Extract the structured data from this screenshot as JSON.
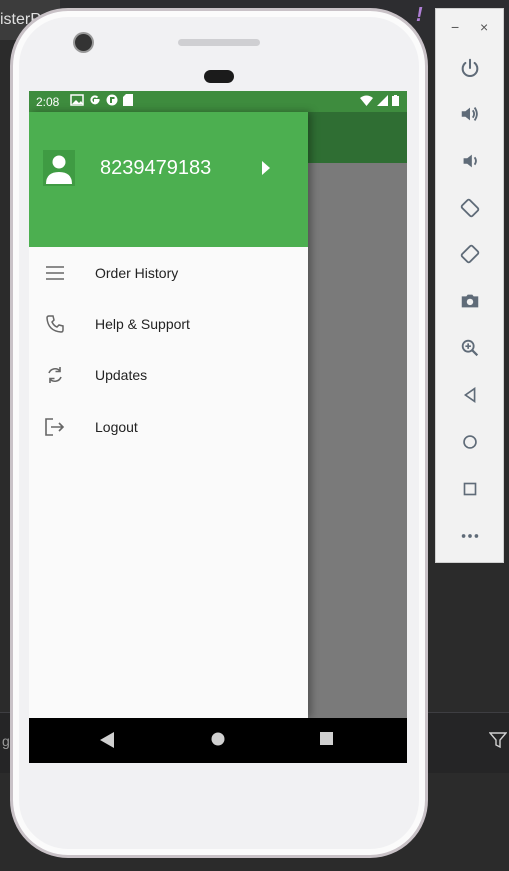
{
  "ide": {
    "tab_fragment": "isterP",
    "bottom_fragment": "g"
  },
  "emulator_toolbar": {
    "minimize_label": "−",
    "close_label": "×",
    "buttons": [
      "power-icon",
      "volume-up-icon",
      "volume-down-icon",
      "rotate-left-icon",
      "rotate-right-icon",
      "camera-icon",
      "zoom-icon",
      "back-icon",
      "home-icon",
      "overview-icon",
      "more-icon"
    ]
  },
  "status_bar": {
    "time": "2:08"
  },
  "drawer": {
    "phone_number": "8239479183",
    "items": [
      {
        "label": "Order History",
        "icon": "menu-icon"
      },
      {
        "label": "Help & Support",
        "icon": "phone-icon"
      },
      {
        "label": "Updates",
        "icon": "sync-icon"
      },
      {
        "label": "Logout",
        "icon": "logout-icon"
      }
    ]
  },
  "colors": {
    "drawer_header": "#4caf50",
    "status_bar": "#3e8c3e",
    "app_bar": "#2f6e33"
  }
}
